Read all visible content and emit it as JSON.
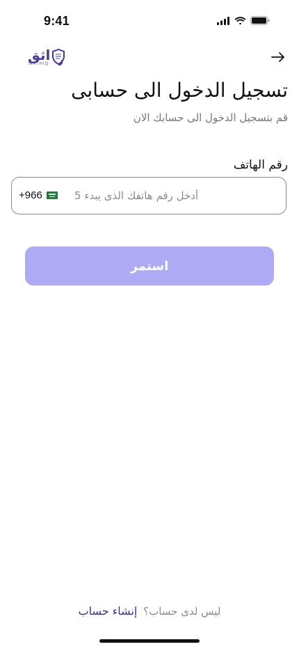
{
  "status_bar": {
    "time": "9:41"
  },
  "header": {
    "logo_text": "اثق",
    "logo_subtext": "WATHIQ",
    "back_icon": "arrow-right-icon"
  },
  "title": "تسجيل الدخول الى حسابى",
  "subtitle": "قم بتسجيل الدخول الى حسابك الان",
  "phone": {
    "label": "رقم الهاتف",
    "placeholder": "أدخل رقم هاتفك الذى يبدء 5",
    "value": "",
    "country_code": "+966",
    "flag_icon": "saudi-flag-icon"
  },
  "continue_button": {
    "label": "استمر",
    "color": "#aeaaf3"
  },
  "footer": {
    "prompt": "ليس لدى حساب؟",
    "signup_link": "إنشاء حساب"
  },
  "colors": {
    "brand": "#3d2f8f",
    "button_disabled": "#aeaaf3",
    "muted_text": "#777777"
  }
}
